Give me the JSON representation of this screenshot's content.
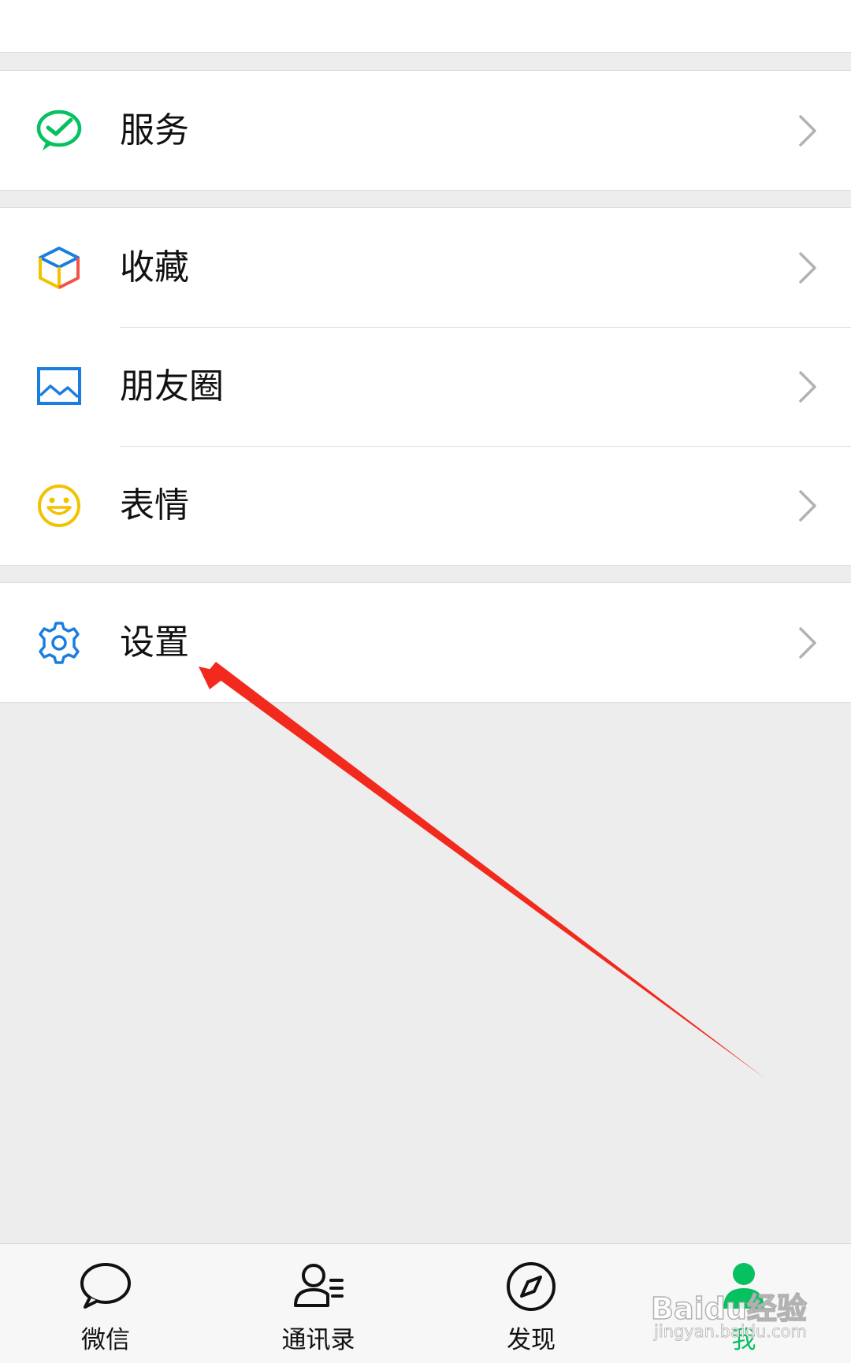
{
  "menu": {
    "groups": [
      {
        "items": [
          {
            "label": "服务",
            "icon": "wechat-pay-icon"
          }
        ]
      },
      {
        "items": [
          {
            "label": "收藏",
            "icon": "favorites-cube-icon"
          },
          {
            "label": "朋友圈",
            "icon": "moments-image-icon"
          },
          {
            "label": "表情",
            "icon": "smiley-icon"
          }
        ]
      },
      {
        "items": [
          {
            "label": "设置",
            "icon": "gear-icon"
          }
        ]
      }
    ]
  },
  "tabbar": {
    "tabs": [
      {
        "label": "微信",
        "icon": "chat-bubble-icon",
        "active": false
      },
      {
        "label": "通讯录",
        "icon": "contacts-icon",
        "active": false
      },
      {
        "label": "发现",
        "icon": "compass-icon",
        "active": false
      },
      {
        "label": "我",
        "icon": "person-icon",
        "active": true
      }
    ]
  },
  "watermark": {
    "brand": "Baidu经验",
    "url": "jingyan.baidu.com"
  },
  "colors": {
    "accent": "#07c160",
    "annotation_arrow": "#f22a1e",
    "icon_blue": "#1a7ee0",
    "icon_yellow": "#f2c200"
  }
}
